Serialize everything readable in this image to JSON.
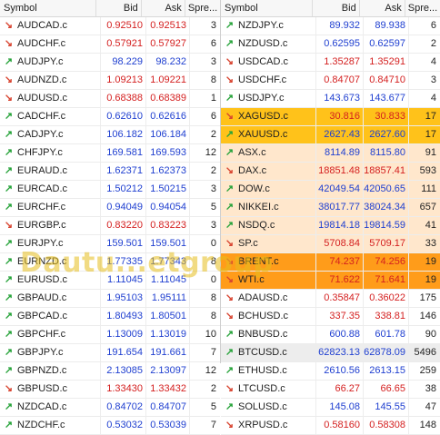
{
  "colors": {
    "up_arrow": "#27a33a",
    "down_arrow": "#d8432f",
    "up_price": "#1f3fd0",
    "down_price": "#d41f1f",
    "highlight_gold": "#ffc21a",
    "highlight_orange": "#ff9c1a",
    "highlight_peach": "#ffe7cc"
  },
  "icons": {
    "up": "arrow-up-right-icon",
    "down": "arrow-down-right-icon"
  },
  "watermark": "Dautu...etgroup",
  "left": {
    "headers": {
      "symbol": "Symbol",
      "bid": "Bid",
      "ask": "Ask",
      "spread": "Spre..."
    },
    "rows": [
      {
        "symbol": "AUDCAD.c",
        "bid": "0.92510",
        "ask": "0.92513",
        "spread": "3",
        "dir": "down"
      },
      {
        "symbol": "AUDCHF.c",
        "bid": "0.57921",
        "ask": "0.57927",
        "spread": "6",
        "dir": "down"
      },
      {
        "symbol": "AUDJPY.c",
        "bid": "98.229",
        "ask": "98.232",
        "spread": "3",
        "dir": "up"
      },
      {
        "symbol": "AUDNZD.c",
        "bid": "1.09213",
        "ask": "1.09221",
        "spread": "8",
        "dir": "down"
      },
      {
        "symbol": "AUDUSD.c",
        "bid": "0.68388",
        "ask": "0.68389",
        "spread": "1",
        "dir": "down"
      },
      {
        "symbol": "CADCHF.c",
        "bid": "0.62610",
        "ask": "0.62616",
        "spread": "6",
        "dir": "up"
      },
      {
        "symbol": "CADJPY.c",
        "bid": "106.182",
        "ask": "106.184",
        "spread": "2",
        "dir": "up"
      },
      {
        "symbol": "CHFJPY.c",
        "bid": "169.581",
        "ask": "169.593",
        "spread": "12",
        "dir": "up"
      },
      {
        "symbol": "EURAUD.c",
        "bid": "1.62371",
        "ask": "1.62373",
        "spread": "2",
        "dir": "up"
      },
      {
        "symbol": "EURCAD.c",
        "bid": "1.50212",
        "ask": "1.50215",
        "spread": "3",
        "dir": "up"
      },
      {
        "symbol": "EURCHF.c",
        "bid": "0.94049",
        "ask": "0.94054",
        "spread": "5",
        "dir": "up"
      },
      {
        "symbol": "EURGBP.c",
        "bid": "0.83220",
        "ask": "0.83223",
        "spread": "3",
        "dir": "down"
      },
      {
        "symbol": "EURJPY.c",
        "bid": "159.501",
        "ask": "159.501",
        "spread": "0",
        "dir": "up"
      },
      {
        "symbol": "EURNZD.c",
        "bid": "1.77335",
        "ask": "1.77343",
        "spread": "8",
        "dir": "up"
      },
      {
        "symbol": "EURUSD.c",
        "bid": "1.11045",
        "ask": "1.11045",
        "spread": "0",
        "dir": "up"
      },
      {
        "symbol": "GBPAUD.c",
        "bid": "1.95103",
        "ask": "1.95111",
        "spread": "8",
        "dir": "up"
      },
      {
        "symbol": "GBPCAD.c",
        "bid": "1.80493",
        "ask": "1.80501",
        "spread": "8",
        "dir": "up"
      },
      {
        "symbol": "GBPCHF.c",
        "bid": "1.13009",
        "ask": "1.13019",
        "spread": "10",
        "dir": "up"
      },
      {
        "symbol": "GBPJPY.c",
        "bid": "191.654",
        "ask": "191.661",
        "spread": "7",
        "dir": "up"
      },
      {
        "symbol": "GBPNZD.c",
        "bid": "2.13085",
        "ask": "2.13097",
        "spread": "12",
        "dir": "up"
      },
      {
        "symbol": "GBPUSD.c",
        "bid": "1.33430",
        "ask": "1.33432",
        "spread": "2",
        "dir": "down"
      },
      {
        "symbol": "NZDCAD.c",
        "bid": "0.84702",
        "ask": "0.84707",
        "spread": "5",
        "dir": "up"
      },
      {
        "symbol": "NZDCHF.c",
        "bid": "0.53032",
        "ask": "0.53039",
        "spread": "7",
        "dir": "up"
      }
    ]
  },
  "right": {
    "headers": {
      "symbol": "Symbol",
      "bid": "Bid",
      "ask": "Ask",
      "spread": "Spre..."
    },
    "rows": [
      {
        "symbol": "NZDJPY.c",
        "bid": "89.932",
        "ask": "89.938",
        "spread": "6",
        "dir": "up",
        "hl": ""
      },
      {
        "symbol": "NZDUSD.c",
        "bid": "0.62595",
        "ask": "0.62597",
        "spread": "2",
        "dir": "up",
        "hl": ""
      },
      {
        "symbol": "USDCAD.c",
        "bid": "1.35287",
        "ask": "1.35291",
        "spread": "4",
        "dir": "down",
        "hl": ""
      },
      {
        "symbol": "USDCHF.c",
        "bid": "0.84707",
        "ask": "0.84710",
        "spread": "3",
        "dir": "down",
        "hl": ""
      },
      {
        "symbol": "USDJPY.c",
        "bid": "143.673",
        "ask": "143.677",
        "spread": "4",
        "dir": "up",
        "hl": ""
      },
      {
        "symbol": "XAGUSD.c",
        "bid": "30.816",
        "ask": "30.833",
        "spread": "17",
        "dir": "down",
        "hl": "gold"
      },
      {
        "symbol": "XAUUSD.c",
        "bid": "2627.43",
        "ask": "2627.60",
        "spread": "17",
        "dir": "up",
        "hl": "gold"
      },
      {
        "symbol": "ASX.c",
        "bid": "8114.89",
        "ask": "8115.80",
        "spread": "91",
        "dir": "up",
        "hl": "peach"
      },
      {
        "symbol": "DAX.c",
        "bid": "18851.48",
        "ask": "18857.41",
        "spread": "593",
        "dir": "down",
        "hl": "peach"
      },
      {
        "symbol": "DOW.c",
        "bid": "42049.54",
        "ask": "42050.65",
        "spread": "111",
        "dir": "up",
        "hl": "peach"
      },
      {
        "symbol": "NIKKEI.c",
        "bid": "38017.77",
        "ask": "38024.34",
        "spread": "657",
        "dir": "up",
        "hl": "peach"
      },
      {
        "symbol": "NSDQ.c",
        "bid": "19814.18",
        "ask": "19814.59",
        "spread": "41",
        "dir": "up",
        "hl": "peach"
      },
      {
        "symbol": "SP.c",
        "bid": "5708.84",
        "ask": "5709.17",
        "spread": "33",
        "dir": "down",
        "hl": "peach"
      },
      {
        "symbol": "BRENT.c",
        "bid": "74.237",
        "ask": "74.256",
        "spread": "19",
        "dir": "down",
        "hl": "orange"
      },
      {
        "symbol": "WTI.c",
        "bid": "71.622",
        "ask": "71.641",
        "spread": "19",
        "dir": "down",
        "hl": "orange"
      },
      {
        "symbol": "ADAUSD.c",
        "bid": "0.35847",
        "ask": "0.36022",
        "spread": "175",
        "dir": "down",
        "hl": ""
      },
      {
        "symbol": "BCHUSD.c",
        "bid": "337.35",
        "ask": "338.81",
        "spread": "146",
        "dir": "down",
        "hl": ""
      },
      {
        "symbol": "BNBUSD.c",
        "bid": "600.88",
        "ask": "601.78",
        "spread": "90",
        "dir": "up",
        "hl": ""
      },
      {
        "symbol": "BTCUSD.c",
        "bid": "62823.13",
        "ask": "62878.09",
        "spread": "5496",
        "dir": "up",
        "hl": "gray"
      },
      {
        "symbol": "ETHUSD.c",
        "bid": "2610.56",
        "ask": "2613.15",
        "spread": "259",
        "dir": "up",
        "hl": ""
      },
      {
        "symbol": "LTCUSD.c",
        "bid": "66.27",
        "ask": "66.65",
        "spread": "38",
        "dir": "down",
        "hl": ""
      },
      {
        "symbol": "SOLUSD.c",
        "bid": "145.08",
        "ask": "145.55",
        "spread": "47",
        "dir": "up",
        "hl": ""
      },
      {
        "symbol": "XRPUSD.c",
        "bid": "0.58160",
        "ask": "0.58308",
        "spread": "148",
        "dir": "down",
        "hl": ""
      }
    ]
  }
}
